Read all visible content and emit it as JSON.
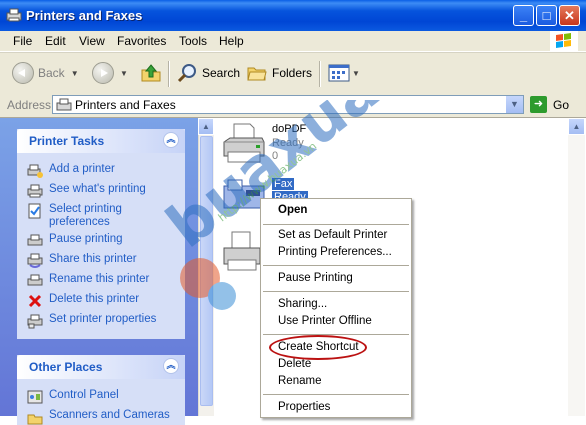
{
  "window": {
    "title": "Printers and Faxes"
  },
  "menu": {
    "items": [
      "File",
      "Edit",
      "View",
      "Favorites",
      "Tools",
      "Help"
    ]
  },
  "toolbar": {
    "back_label": "Back",
    "search_label": "Search",
    "folders_label": "Folders"
  },
  "address": {
    "label": "Address",
    "value": "Printers and Faxes",
    "go_label": "Go"
  },
  "tasks_panel": {
    "title": "Printer Tasks",
    "items": [
      {
        "label": "Add a printer",
        "icon": "add-printer-icon"
      },
      {
        "label": "See what's printing",
        "icon": "printer-queue-icon"
      },
      {
        "label": "Select printing preferences",
        "icon": "preferences-icon"
      },
      {
        "label": "Pause printing",
        "icon": "pause-printer-icon"
      },
      {
        "label": "Share this printer",
        "icon": "share-printer-icon"
      },
      {
        "label": "Rename this printer",
        "icon": "rename-printer-icon"
      },
      {
        "label": "Delete this printer",
        "icon": "delete-icon"
      },
      {
        "label": "Set printer properties",
        "icon": "properties-icon"
      }
    ]
  },
  "places_panel": {
    "title": "Other Places",
    "items": [
      {
        "label": "Control Panel",
        "icon": "control-panel-icon"
      },
      {
        "label": "Scanners and Cameras",
        "icon": "scanner-icon"
      }
    ]
  },
  "printers": [
    {
      "name": "doPDF",
      "status": "Ready",
      "count": "0"
    },
    {
      "name": "Fax",
      "status": "Ready",
      "count": ""
    }
  ],
  "context_menu": {
    "items": [
      {
        "label": "Open",
        "bold": true
      },
      {
        "label": "Set as Default Printer"
      },
      {
        "label": "Printing Preferences..."
      },
      {
        "label": "Pause Printing"
      },
      {
        "label": "Sharing..."
      },
      {
        "label": "Use Printer Offline"
      },
      {
        "label": "Create Shortcut",
        "highlighted": true
      },
      {
        "label": "Delete"
      },
      {
        "label": "Rename"
      },
      {
        "label": "Properties"
      }
    ]
  },
  "watermark": {
    "url_text": "http://www.buaxua.vn",
    "brand_text": "buaxua"
  },
  "colors": {
    "titlebar": "#0046d5",
    "task_link": "#215dc6",
    "highlight_ellipse": "#bb1111"
  }
}
